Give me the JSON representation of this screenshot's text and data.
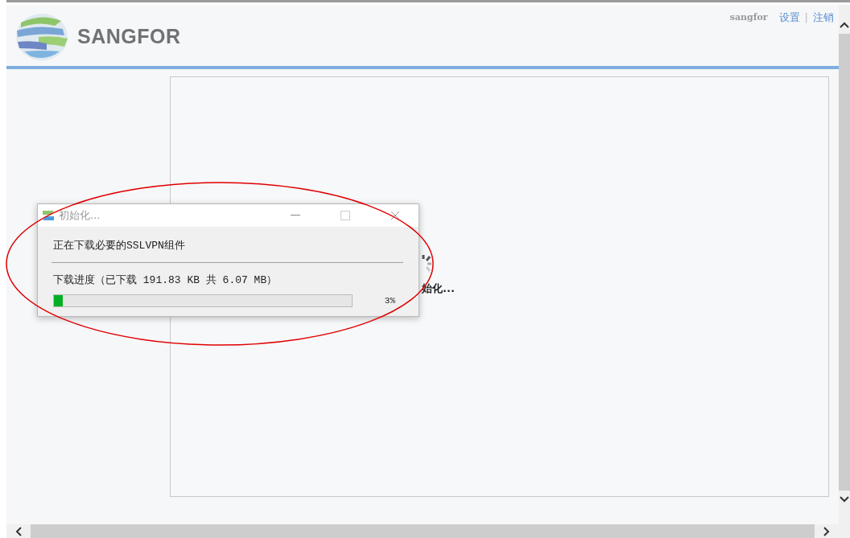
{
  "header": {
    "logo_text": "SANGFOR",
    "user": "sangfor",
    "separator": "|",
    "links": [
      {
        "label": "设置"
      },
      {
        "label": "注销"
      }
    ]
  },
  "background_status": {
    "text": "始化..."
  },
  "dialog": {
    "title": "初始化...",
    "message": "正在下载必要的SSLVPN组件",
    "progress_label": "下载进度（已下载  191.83 KB 共 6.07 MB）",
    "level": 0.03,
    "percent": "3%"
  }
}
